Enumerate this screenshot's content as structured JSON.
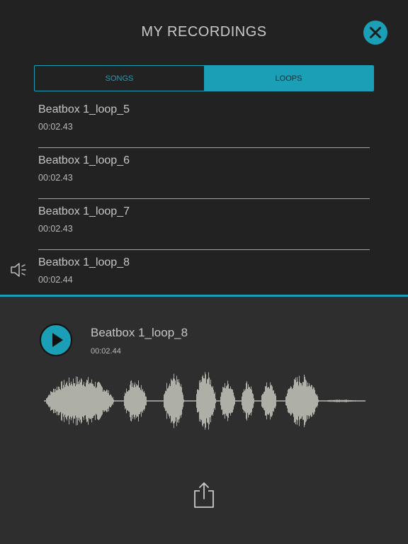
{
  "header": {
    "title": "MY RECORDINGS",
    "close_icon": "close-x-icon"
  },
  "tabs": [
    {
      "label": "SONGS",
      "active": false
    },
    {
      "label": "LOOPS",
      "active": true
    }
  ],
  "recordings": [
    {
      "name": "Beatbox 1_loop_5",
      "duration": "00:02.43"
    },
    {
      "name": "Beatbox 1_loop_6",
      "duration": "00:02.43"
    },
    {
      "name": "Beatbox 1_loop_7",
      "duration": "00:02.43"
    },
    {
      "name": "Beatbox 1_loop_8",
      "duration": "00:02.44"
    }
  ],
  "player": {
    "name": "Beatbox 1_loop_8",
    "duration": "00:02.44",
    "play_icon": "play-icon",
    "share_icon": "share-icon",
    "speaker_icon": "speaker-icon"
  },
  "colors": {
    "accent": "#1a9fb6",
    "background": "#222222",
    "player_background": "#2e2e2e",
    "waveform": "#aeb0a8"
  }
}
